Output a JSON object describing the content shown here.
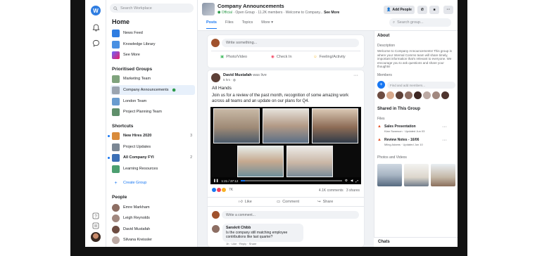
{
  "rail": {
    "logo": "W",
    "icons": [
      "bell-icon",
      "chat-icon"
    ]
  },
  "nav": {
    "search_placeholder": "Search Workplace",
    "home": "Home",
    "main_items": [
      {
        "label": "News Feed",
        "color": "#2f7de1"
      },
      {
        "label": "Knowledge Library",
        "color": "#4a90e2"
      },
      {
        "label": "See More",
        "color": "#6c63ff"
      }
    ],
    "groups_title": "Prioritised Groups",
    "groups": [
      {
        "label": "Marketing Team"
      },
      {
        "label": "Company Announcements",
        "active": true
      },
      {
        "label": "London Team"
      },
      {
        "label": "Project Planning Team"
      }
    ],
    "shortcuts_title": "Shortcuts",
    "shortcuts": [
      {
        "label": "New Hires 2020",
        "count": "3",
        "bold": true
      },
      {
        "label": "Project Updates"
      },
      {
        "label": "All Company FYI",
        "count": "2",
        "bold": true
      },
      {
        "label": "Learning Resources"
      },
      {
        "label": "Create Group"
      }
    ],
    "people_title": "People",
    "people": [
      "Emre Markham",
      "Leigh Reynolds",
      "David Mustafah",
      "Silvana Kreissler"
    ]
  },
  "group": {
    "title": "Company Announcements",
    "official": "Official",
    "type": "Open Group",
    "members": "11.2K members",
    "description_short": "Welcome to Company...",
    "see_more": "See More",
    "add_people": "Add People",
    "tabs": [
      "Posts",
      "Files",
      "Topics",
      "More"
    ],
    "search_placeholder": "Search group..."
  },
  "composer": {
    "placeholder": "Write something...",
    "actions": [
      "Photo/Video",
      "Check In",
      "Feeling/Activity"
    ]
  },
  "post": {
    "author": "David Mustafah",
    "verb": "was live",
    "time": "5 hrs",
    "title": "All Hands",
    "text": "Join us for a review of the past month, recognition of some amazing work across all teams and an update on our plans for Q4.",
    "video_time": "1:21 / 37:12",
    "reactions": "7K",
    "comments": "4.1K comments",
    "shares": "3 shares",
    "actions": [
      "Like",
      "Comment",
      "Share"
    ],
    "comment_placeholder": "Write a comment...",
    "comment": {
      "author": "Sanskrit Chibb",
      "text": "Is the company still matching employee contributions like last quarter?",
      "meta": "1h · Like · Reply · Share"
    }
  },
  "about": {
    "title": "About",
    "description_label": "Description",
    "description": "Welcome to Company Announcements! This group is where your Internal Comms team will share timely, important information that's relevant to everyone. We encourage you to ask questions and share your thoughts!",
    "members_label": "Members",
    "add_members_placeholder": "Find and add members...",
    "shared_title": "Shared in This Group",
    "files_label": "Files",
    "files": [
      {
        "name": "Sales Presentation",
        "meta": "Kian Swanson · Updated Jun 03"
      },
      {
        "name": "Review Notes - 16/06",
        "meta": "Miing Adams · Updated Jun 10"
      }
    ],
    "photos_label": "Photos and Videos"
  },
  "chats": "Chats"
}
